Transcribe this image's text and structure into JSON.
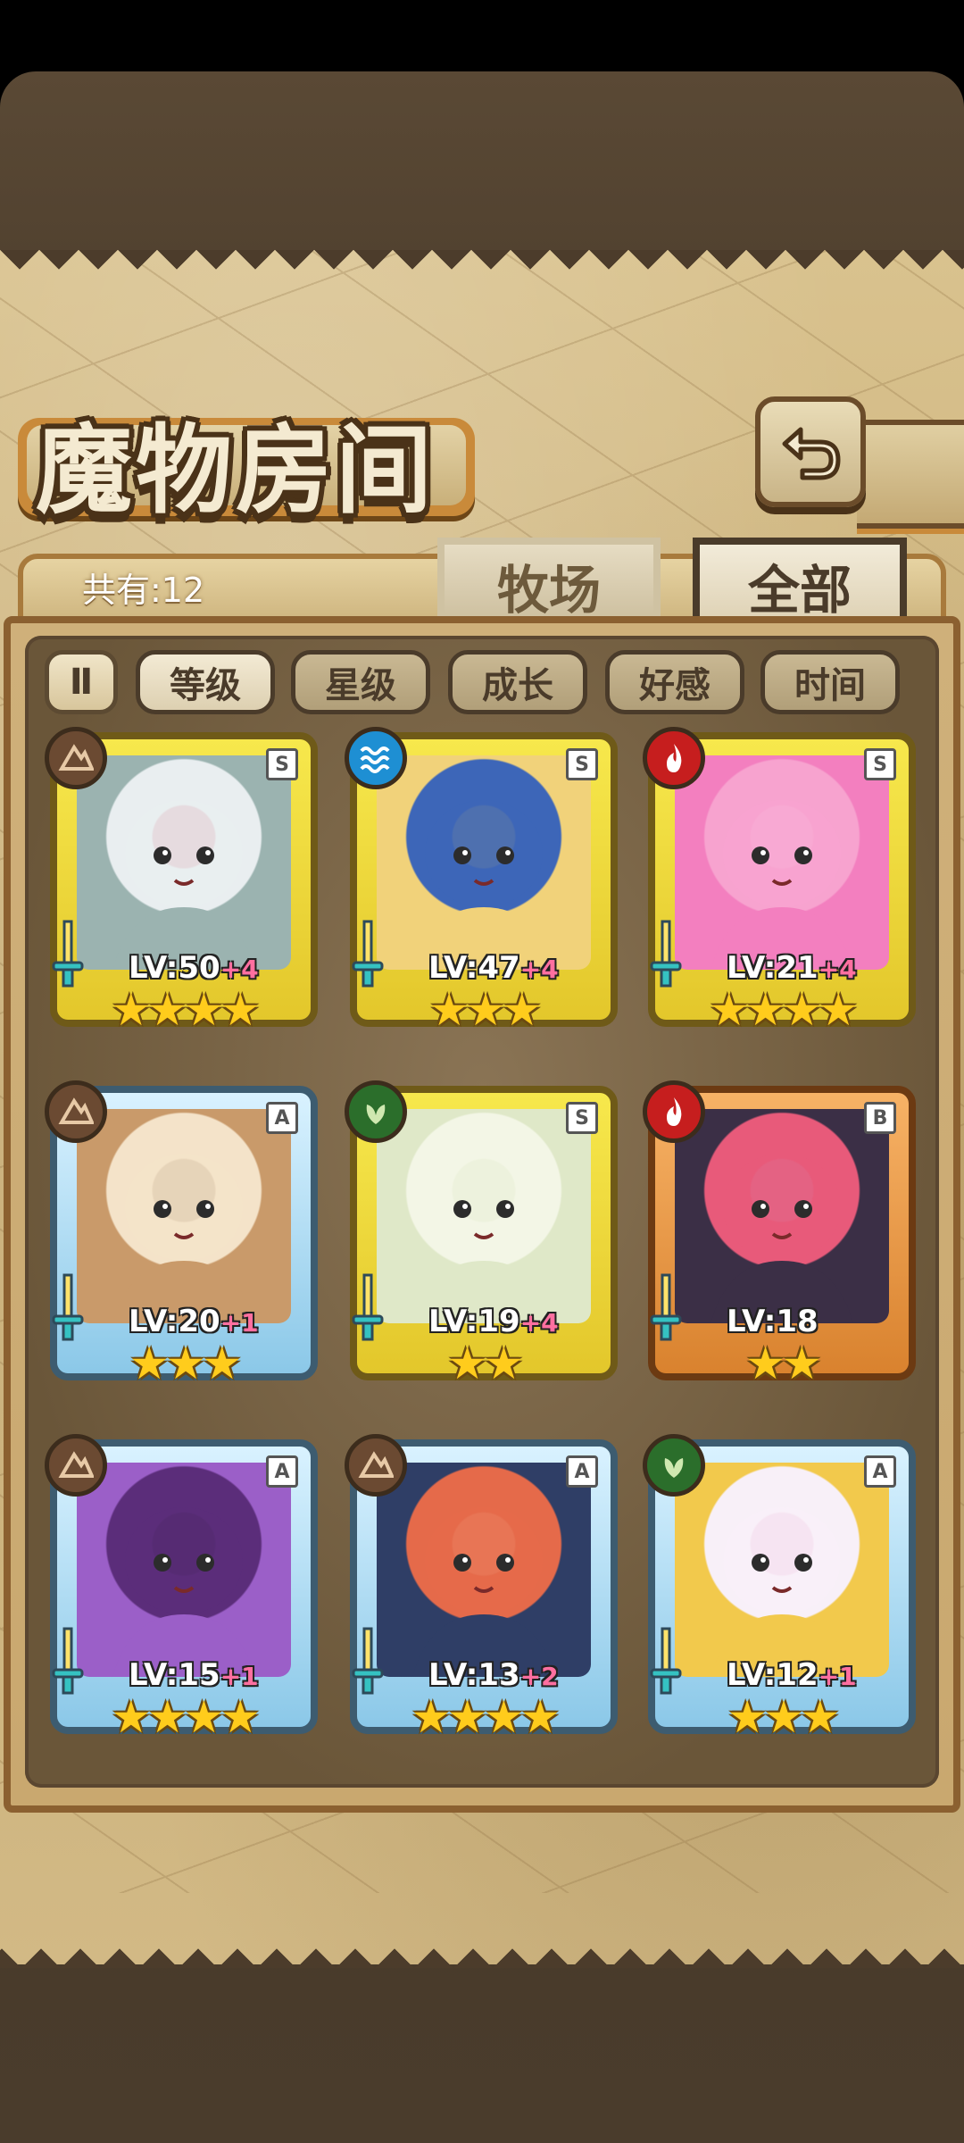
{
  "header": {
    "title": "魔物房间"
  },
  "count": {
    "label": "共有:12"
  },
  "tabs": [
    {
      "label": "牧场",
      "active": false
    },
    {
      "label": "全部",
      "active": true
    }
  ],
  "sort": {
    "toggle": "Ⅱ",
    "buttons": [
      {
        "label": "等级",
        "active": true
      },
      {
        "label": "星级",
        "active": false
      },
      {
        "label": "成长",
        "active": false
      },
      {
        "label": "好感",
        "active": false
      },
      {
        "label": "时间",
        "active": false
      }
    ]
  },
  "monsters": [
    {
      "lv": "LV:50",
      "plus": "+4",
      "rank": "S",
      "element": "earth",
      "stars": "★★★★",
      "frame": "gold"
    },
    {
      "lv": "LV:47",
      "plus": "+4",
      "rank": "S",
      "element": "water",
      "stars": "★★★",
      "frame": "gold"
    },
    {
      "lv": "LV:21",
      "plus": "+4",
      "rank": "S",
      "element": "fire",
      "stars": "★★★★",
      "frame": "gold"
    },
    {
      "lv": "LV:20",
      "plus": "+1",
      "rank": "A",
      "element": "earth",
      "stars": "★★★",
      "frame": "blue"
    },
    {
      "lv": "LV:19",
      "plus": "+4",
      "rank": "S",
      "element": "nature",
      "stars": "★★",
      "frame": "gold"
    },
    {
      "lv": "LV:18",
      "plus": "",
      "rank": "B",
      "element": "fire",
      "stars": "★★",
      "frame": "orange"
    },
    {
      "lv": "LV:15",
      "plus": "+1",
      "rank": "A",
      "element": "earth",
      "stars": "★★★★",
      "frame": "blue"
    },
    {
      "lv": "LV:13",
      "plus": "+2",
      "rank": "A",
      "element": "earth",
      "stars": "★★★★",
      "frame": "blue"
    },
    {
      "lv": "LV:12",
      "plus": "+1",
      "rank": "A",
      "element": "nature",
      "stars": "★★★",
      "frame": "blue"
    }
  ],
  "colors": {
    "gold_frame": "#f7e84c",
    "blue_frame": "#8bc8e8",
    "orange_frame": "#d9822e",
    "plus_text": "#ff6fa0",
    "star": "#ffcc1c"
  }
}
